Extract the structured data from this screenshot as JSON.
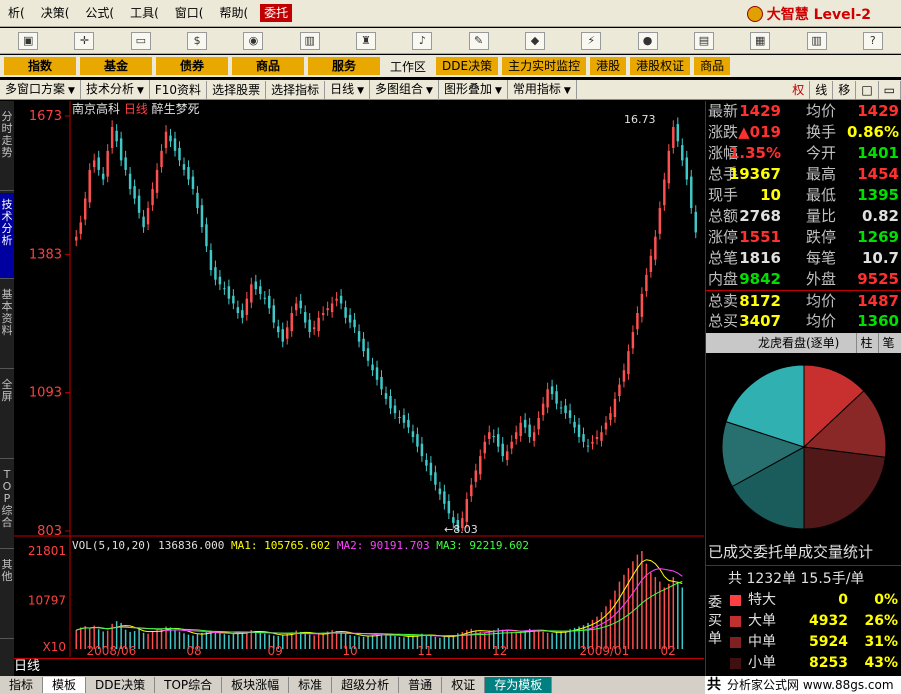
{
  "menu": [
    "析(",
    "决策(",
    "公式(",
    "工具(",
    "窗口(",
    "帮助(",
    "委托"
  ],
  "brand": {
    "title": "大智慧 Level-2"
  },
  "toolbar_icons": [
    "monitor-icon",
    "crosshair-icon",
    "ruler-icon",
    "dollar-icon",
    "traffic-light-icon",
    "bar-pattern-icon",
    "binoculars-icon",
    "bell-icon",
    "chart-pen-icon",
    "diamond-icon",
    "lightning-icon",
    "circle-icon",
    "printer-icon",
    "window-icon",
    "books-icon",
    "help-icon"
  ],
  "categories": [
    "指数",
    "基金",
    "债券",
    "商品",
    "服务"
  ],
  "workspace_label": "工作区",
  "quick_links": [
    "DDE决策",
    "主力实时监控",
    "港股",
    "港股权证",
    "商品"
  ],
  "funcbar": [
    {
      "label": "多窗口方案",
      "dropdown": true
    },
    {
      "label": "技术分析",
      "dropdown": true
    },
    {
      "label": "F10资料",
      "dropdown": false
    },
    {
      "label": "选择股票",
      "dropdown": false
    },
    {
      "label": "选择指标",
      "dropdown": false
    },
    {
      "label": "日线",
      "dropdown": true
    },
    {
      "label": "多图组合",
      "dropdown": true
    },
    {
      "label": "图形叠加",
      "dropdown": true
    },
    {
      "label": "常用指标",
      "dropdown": true
    }
  ],
  "funcbar_right": [
    "权",
    "线",
    "移"
  ],
  "sidebar": [
    "分时走势",
    "技术分析",
    "基本资料",
    "全屏",
    "TOP综合",
    "其他"
  ],
  "chart_header": {
    "stock": "南京高科",
    "period": "日线",
    "indicator": "醉生梦死"
  },
  "vol_header": {
    "name": "VOL(5,10,20)",
    "vol": "136836.000",
    "ma1": "MA1: 105765.602",
    "ma2": "MA2: 90191.703",
    "ma3": "MA3: 92219.602"
  },
  "bottom_period": "日线",
  "x_labels": [
    "2008/06",
    "08",
    "09",
    "10",
    "11",
    "12",
    "2009/01",
    "02"
  ],
  "bottom_tabs": [
    "指标",
    "模板",
    "DDE决策",
    "TOP综合",
    "板块涨幅",
    "标准",
    "超级分析",
    "普通",
    "权证",
    "存为模板"
  ],
  "footer_mark": {
    "glyph": "共",
    "text": "分析家公式网 www.88gs.com"
  },
  "quotes": [
    {
      "l1": "最新",
      "v1": "1429",
      "c1": "red",
      "l2": "均价",
      "v2": "1429",
      "c2": "red"
    },
    {
      "l1": "涨跌",
      "v1": "▲019",
      "c1": "red",
      "l2": "换手",
      "v2": "0.86%",
      "c2": "yel"
    },
    {
      "l1": "涨幅",
      "v1": "1.35%",
      "c1": "red",
      "l2": "今开",
      "v2": "1401",
      "c2": "grn"
    },
    {
      "l1": "总手",
      "v1": "19367",
      "c1": "yel",
      "l2": "最高",
      "v2": "1454",
      "c2": "red"
    },
    {
      "l1": "现手",
      "v1": "10",
      "c1": "yel",
      "l2": "最低",
      "v2": "1395",
      "c2": "grn"
    },
    {
      "l1": "总额",
      "v1": "2768",
      "c1": "wht",
      "l2": "量比",
      "v2": "0.82",
      "c2": "wht"
    },
    {
      "l1": "涨停",
      "v1": "1551",
      "c1": "red",
      "l2": "跌停",
      "v2": "1269",
      "c2": "grn"
    },
    {
      "l1": "总笔",
      "v1": "1816",
      "c1": "wht",
      "l2": "每笔",
      "v2": "10.7",
      "c2": "wht"
    },
    {
      "l1": "内盘",
      "v1": "9842",
      "c1": "grn",
      "l2": "外盘",
      "v2": "9525",
      "c2": "red"
    },
    {
      "l1": "总卖",
      "v1": "8172",
      "c1": "yel",
      "l2": "均价",
      "v2": "1487",
      "c2": "red"
    },
    {
      "l1": "总买",
      "v1": "3407",
      "c1": "yel",
      "l2": "均价",
      "v2": "1360",
      "c2": "grn"
    }
  ],
  "lhb": {
    "title": "龙虎看盘(逐单)",
    "btn1": "柱",
    "btn2": "笔"
  },
  "vol_stats": {
    "title": "已成交委托单成交量统计",
    "head": "共 1232单 15.5手/单",
    "side": "委买单",
    "rows": [
      {
        "label": "特大",
        "value": "0",
        "pct": "0%",
        "color": "#ff4040"
      },
      {
        "label": "大单",
        "value": "4932",
        "pct": "26%",
        "color": "#c03030"
      },
      {
        "label": "中单",
        "value": "5924",
        "pct": "31%",
        "color": "#802020"
      },
      {
        "label": "小单",
        "value": "8253",
        "pct": "43%",
        "color": "#401010"
      }
    ]
  },
  "pie": {
    "slices": [
      {
        "label": "red",
        "value": 13,
        "color": "#c83030"
      },
      {
        "label": "darkred1",
        "value": 14,
        "color": "#8a2828"
      },
      {
        "label": "darkred2",
        "value": 23,
        "color": "#501818"
      },
      {
        "label": "teal1",
        "value": 17,
        "color": "#1a5c5c"
      },
      {
        "label": "teal2",
        "value": 13,
        "color": "#287070"
      },
      {
        "label": "teal3",
        "value": 20,
        "color": "#30b0b0"
      }
    ]
  },
  "chart_data": {
    "type": "candlestick",
    "y_ticks": [
      "1673",
      "1383",
      "1093",
      "803"
    ],
    "ylim": [
      803,
      1673
    ],
    "vol_ticks": [
      "21801",
      "10797",
      "X10"
    ],
    "vol_ylim": [
      0,
      21801
    ],
    "annotations": [
      "16.73",
      "8.03"
    ],
    "closes": [
      1420,
      1450,
      1500,
      1560,
      1580,
      1560,
      1540,
      1600,
      1650,
      1620,
      1580,
      1560,
      1520,
      1500,
      1470,
      1440,
      1480,
      1520,
      1560,
      1600,
      1640,
      1620,
      1600,
      1580,
      1560,
      1540,
      1520,
      1480,
      1440,
      1400,
      1350,
      1330,
      1320,
      1310,
      1290,
      1280,
      1260,
      1250,
      1290,
      1320,
      1310,
      1300,
      1290,
      1270,
      1240,
      1220,
      1200,
      1230,
      1260,
      1280,
      1270,
      1240,
      1220,
      1230,
      1250,
      1260,
      1270,
      1280,
      1290,
      1280,
      1250,
      1240,
      1230,
      1200,
      1180,
      1160,
      1140,
      1120,
      1100,
      1080,
      1060,
      1050,
      1040,
      1030,
      1020,
      1000,
      980,
      960,
      940,
      920,
      900,
      880,
      860,
      840,
      820,
      803,
      830,
      870,
      900,
      930,
      960,
      990,
      1010,
      1000,
      980,
      960,
      970,
      990,
      1010,
      1030,
      1020,
      1000,
      1010,
      1040,
      1070,
      1100,
      1090,
      1070,
      1060,
      1050,
      1040,
      1020,
      1000,
      990,
      980,
      990,
      1000,
      1010,
      1030,
      1050,
      1080,
      1110,
      1140,
      1180,
      1220,
      1260,
      1300,
      1340,
      1380,
      1420,
      1480,
      1540,
      1600,
      1650,
      1620,
      1580,
      1540,
      1480,
      1429
    ],
    "volumes": [
      4200,
      4800,
      5100,
      4600,
      5200,
      4400,
      3900,
      4100,
      5600,
      6200,
      5800,
      4300,
      3800,
      4000,
      4500,
      3600,
      3400,
      3900,
      4200,
      4600,
      5000,
      4800,
      4300,
      3900,
      3500,
      3200,
      3000,
      3300,
      3600,
      3900,
      4100,
      3800,
      3500,
      3300,
      3100,
      3400,
      3800,
      3600,
      3900,
      4200,
      4000,
      3700,
      3400,
      3200,
      3000,
      2900,
      3100,
      3400,
      3700,
      4100,
      3800,
      3500,
      3200,
      3000,
      3300,
      3600,
      3900,
      4200,
      4000,
      3700,
      3400,
      3100,
      2900,
      2800,
      2700,
      2900,
      3100,
      3300,
      3500,
      3300,
      3100,
      2900,
      2700,
      2600,
      2800,
      3000,
      3200,
      3400,
      3100,
      2900,
      2700,
      2500,
      2700,
      2900,
      3100,
      3500,
      3800,
      4200,
      4500,
      4100,
      3800,
      3600,
      3900,
      4200,
      4600,
      4300,
      4000,
      3800,
      3700,
      3900,
      4200,
      4500,
      4300,
      4000,
      3800,
      3600,
      3500,
      3700,
      3900,
      4100,
      4400,
      4700,
      5000,
      5300,
      5800,
      6500,
      7200,
      8200,
      9500,
      11000,
      13000,
      15000,
      16500,
      18000,
      19500,
      21000,
      21801,
      19000,
      17000,
      16000,
      15000,
      13683,
      14500,
      16000,
      15000,
      13683
    ]
  }
}
